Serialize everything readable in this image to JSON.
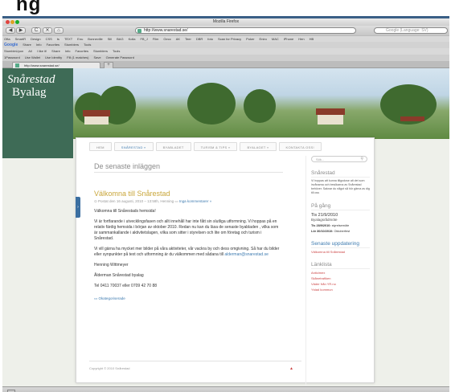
{
  "browser": {
    "window_title": "Mozilla Firefox",
    "url": "http://www.snarestad.se/",
    "search_placeholder": "Google (Language: SV)",
    "tab_title": "http://www.snarestad.se/",
    "new_tab_label": "+",
    "bookmarks": [
      "Ofta",
      "SmartR",
      "Design",
      "CSS",
      "ts",
      "TEXT",
      "Enu",
      "Bonneville",
      "Sill",
      "BAG",
      "Kolla",
      "FB_J",
      "Film",
      "Gecc",
      "AK",
      "Teer",
      "DBR",
      "foto",
      "Scan for Privacy",
      "Poker",
      "Eniro",
      "MAC",
      "iPhone",
      "Hen",
      "HB"
    ],
    "google_bar": [
      "Google",
      "Share",
      "Info",
      "Favorites",
      "Stumblers",
      "Tools"
    ],
    "stumble_bar": [
      "StumbleUpon",
      "All",
      "I like it!",
      "Share",
      "Info",
      "Favorites",
      "Stumblers",
      "Tools"
    ],
    "pass_bar": [
      "1Password",
      "Use Wallet",
      "Use Identity",
      "Fill (1 matches)",
      "Save",
      "Generate Password"
    ],
    "nav": {
      "back": "◀",
      "forward": "▶",
      "reload": "C",
      "stop": "✕",
      "home": "⌂"
    }
  },
  "site": {
    "logo_line1": "Snårestad",
    "logo_line2": "Byalag",
    "menu": [
      {
        "label": "HEM",
        "active": false
      },
      {
        "label": "SNÅRESTAD »",
        "active": true
      },
      {
        "label": "BYABLADET",
        "active": false
      },
      {
        "label": "TURISM & TIPS »",
        "active": false
      },
      {
        "label": "BYALAGET »",
        "active": false
      },
      {
        "label": "KONTAKTA OSS!",
        "active": false
      }
    ],
    "latest_heading": "De senaste inläggen",
    "post": {
      "title": "Välkomna till Snårestad",
      "meta": "Postat den 16 augusti, 2010 – 13:58h, Henning",
      "comments": "Inga kommentarer »",
      "p1": "Välkomna till Snårestads hemsida!",
      "p2": "Vi är fortfarande i utvecklingsfasen och allt innehåll har inte fått sin slutliga utformning. Vi hoppas på en relativ färdig hemsida i början av oktober 2010. Redan nu kan du läsa de senaste byabladen , vilka som är sammankallande i aktivitetslagen, vilka som sitter i styrelsen och lite om företag och turism i Snårestad.",
      "p3": "Vi vill gärna ha mycket mer bilder på våra aktiviteter, vår vackra by och dess omgivning. Så har du bilder eller synpunkter på text och utformning är du välkommen med sådana till",
      "email": "alderman@snarestad.se",
      "sign1": "Henning Wittmeyer",
      "sign2": "Ålderman Snårestad byalag",
      "phone": "Tel 0411 70037 eller 0709 42 70 88",
      "category": "Okategoriserade"
    },
    "side_tab": "›",
    "footer": "Copyright © 2010 Snårestad",
    "footer_up": "▲",
    "sidebar": {
      "search_placeholder": "Sök...",
      "search_icon": "⚲",
      "about_heading": "Snårestad",
      "about_text": "Vi hoppas att kunna tillgodose alt det som invånarna och besökarna av Snårestad behöver. Saknar du något så hör gärna av dig till oss",
      "events_heading": "På gång",
      "event_date": "Tis 21/9/2010",
      "event_title": "Byalagsrådmöte",
      "event_line1_date": "Tis 28/9/2010:",
      "event_line1_text": "styrelsemöte",
      "event_line2_date": "Lör 30/10/2010:",
      "event_line2_text": "Oktoberfest",
      "latest_heading": "Senaste uppdatering",
      "latest_link": "Välkomna till Snårestad",
      "links_heading": "Länklista",
      "links": [
        "Anticimex",
        "Skånetrafiken",
        "Väder från YR.no",
        "Ystad kommun"
      ]
    }
  },
  "colors": {
    "accent_blue": "#3e7bb0",
    "title_gold": "#c9a63a",
    "logo_green": "#3e6b56",
    "link_red": "#c44"
  }
}
